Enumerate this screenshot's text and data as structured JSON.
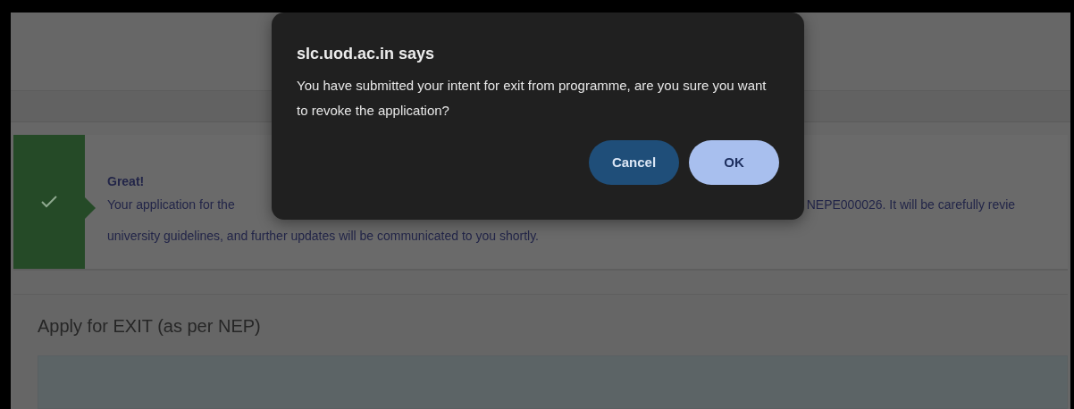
{
  "page": {
    "alert": {
      "title": "Great!",
      "line_1_left": "Your application for the",
      "line_1_right": "NEPE000026. It will be carefully revie",
      "line_2": "university guidelines, and further updates will be communicated to you shortly."
    },
    "section_title": "Apply for EXIT (as per NEP)"
  },
  "dialog": {
    "title": "slc.uod.ac.in says",
    "message": "You have submitted your intent for exit from programme, are you sure you want to revoke the application?",
    "buttons": [
      {
        "label": "Cancel",
        "kind": "secondary"
      },
      {
        "label": "OK",
        "kind": "primary"
      }
    ]
  }
}
